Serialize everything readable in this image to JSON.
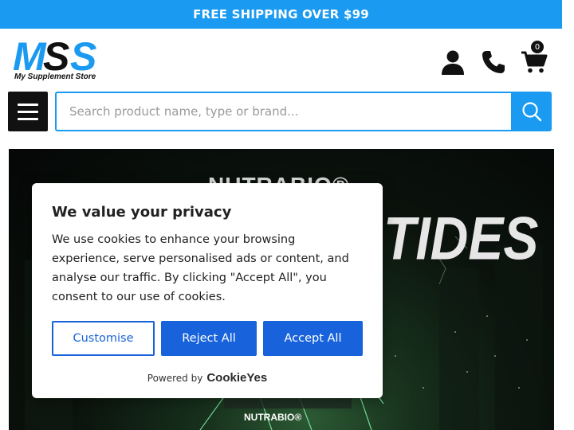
{
  "promo": {
    "text": "FREE SHIPPING OVER $99"
  },
  "logo": {
    "letters": "MSS",
    "tagline": "My Supplement Store"
  },
  "header": {
    "cart_count": "0"
  },
  "search": {
    "placeholder": "Search product name, type or brand..."
  },
  "hero": {
    "brand_top": "NUTRABIO®",
    "title_fragment": "TIDES",
    "brand_bottom": "NUTRABIO®"
  },
  "cookie_banner": {
    "title": "We value your privacy",
    "body": "We use cookies to enhance your browsing experience, serve personalised ads or content, and analyse our traffic. By clicking \"Accept All\", you consent to our use of cookies.",
    "customise_label": "Customise",
    "reject_label": "Reject All",
    "accept_label": "Accept All",
    "powered_by": "Powered by",
    "provider": "CookieYes"
  },
  "colors": {
    "brand_blue": "#1a9af0",
    "consent_blue": "#1863dc",
    "dark": "#111111"
  }
}
